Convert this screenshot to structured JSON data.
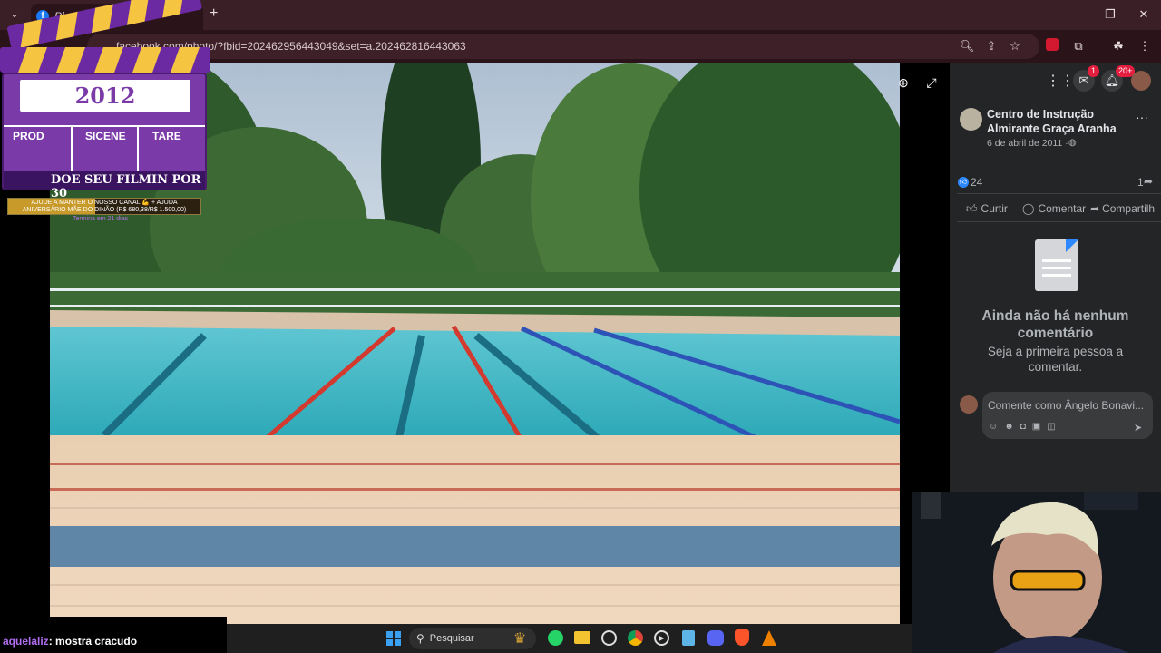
{
  "browser": {
    "tab_title": "Photo",
    "url": "facebook.com/photo/?fbid=202462956443049&set=a.202462816443063",
    "new_tab": "+"
  },
  "overlay": {
    "year": "2012",
    "col1": "PROD",
    "col2": "SICENE",
    "col3": "TARE",
    "footer": "DOE SEU FILMIN POR 30",
    "goal_line1": "AJUDE A MANTER O NOSSO CANAL 💪 + AJUDA",
    "goal_line2": "ANIVERSÁRIO MÃE DO DINÃO (R$ 680,38/R$ 1.500,00)",
    "goal_fraction": 0.454,
    "goal_time": "Termina em 21 dias"
  },
  "fb": {
    "messenger_badge": "1",
    "notif_badge": "20+",
    "page_name_line1": "Centro de Instrução",
    "page_name_line2": "Almirante Graça Aranha",
    "post_date": "6 de abril de 2011 ·",
    "likes": "24",
    "shares": "1",
    "like_label": "Curtir",
    "comment_label": "Comentar",
    "share_label": "Compartilh",
    "empty_title_line1": "Ainda não há nenhum",
    "empty_title_line2": "comentário",
    "empty_sub_line1": "Seja a primeira pessoa a",
    "empty_sub_line2": "comentar.",
    "comment_placeholder": "Comente como Ângelo Bonavi..."
  },
  "taskbar": {
    "search_label": "Pesquisar"
  },
  "chat": {
    "user": "aquelaliz",
    "message": ": mostra cracudo"
  },
  "colors": {
    "fb_bg": "#242526",
    "chrome_bg": "#3a1f26",
    "accent_blue": "#2d88ff",
    "badge_red": "#e41e3f"
  }
}
